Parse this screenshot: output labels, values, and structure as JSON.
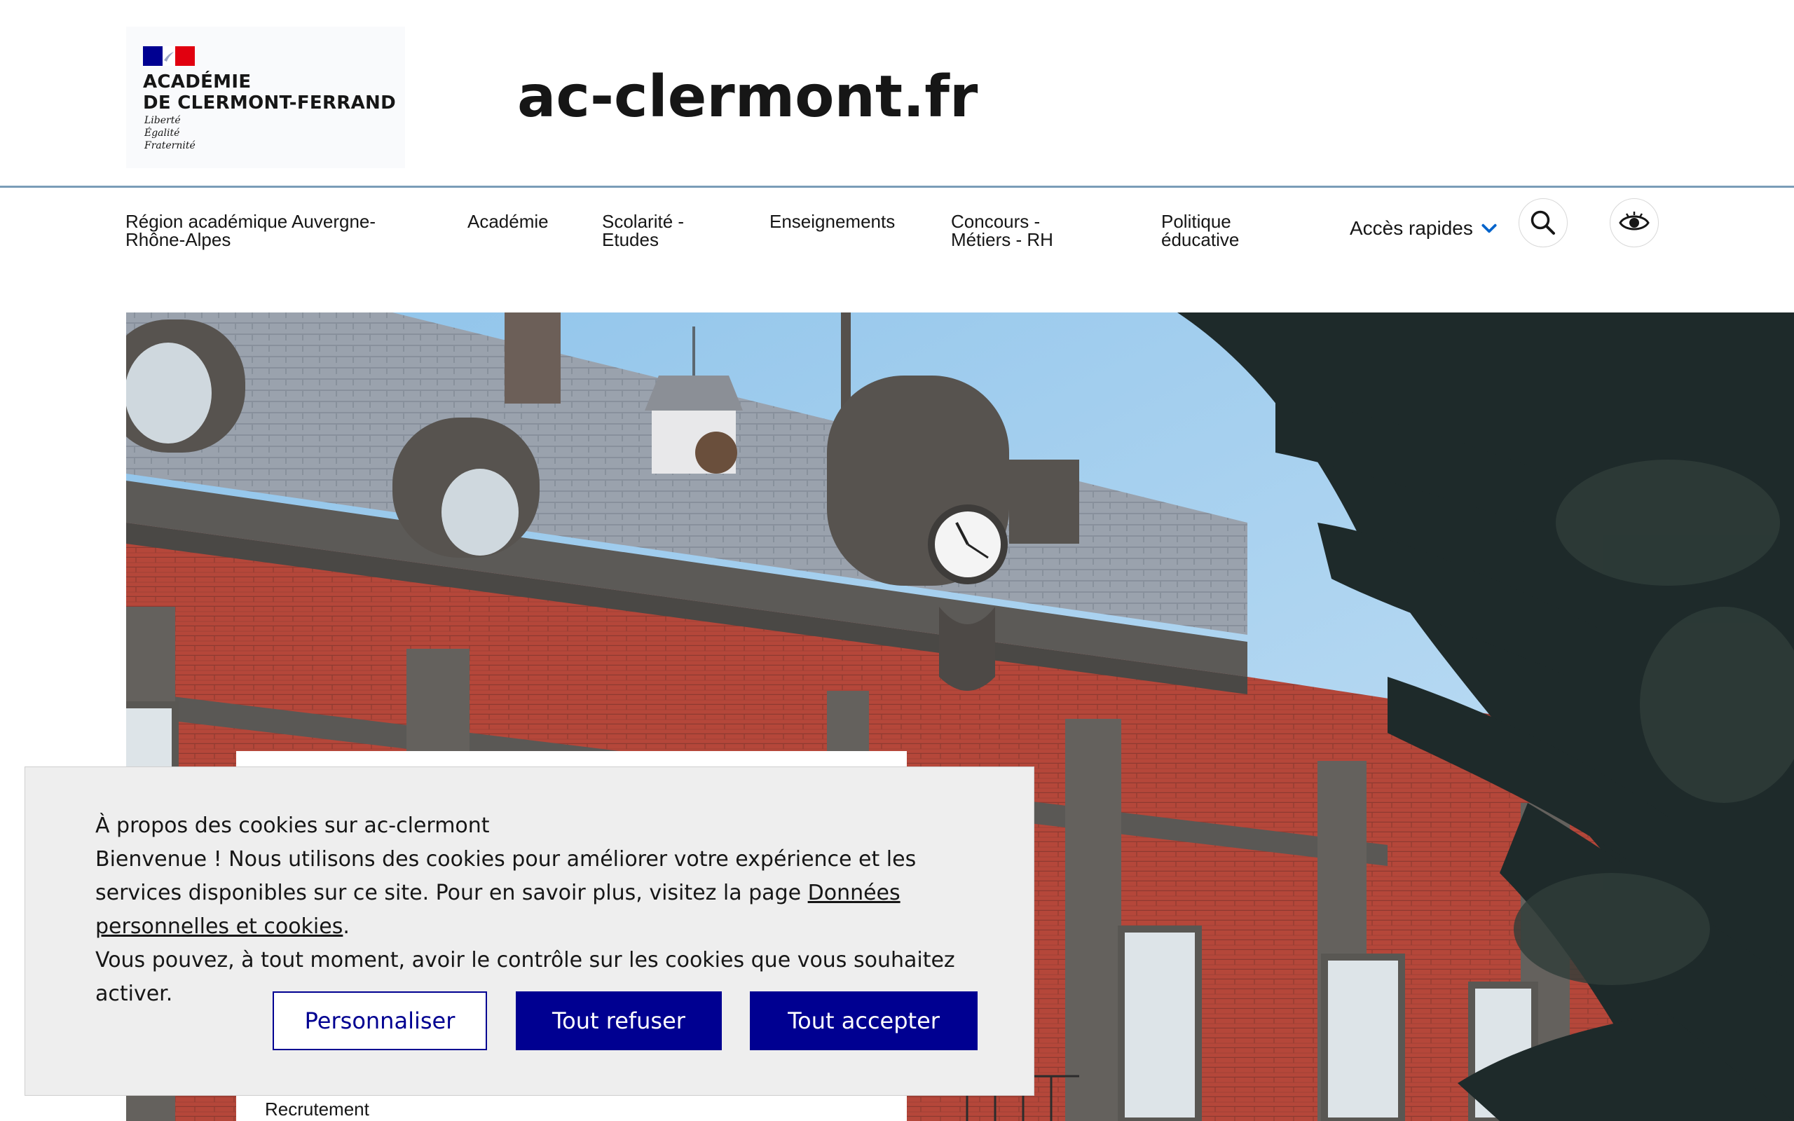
{
  "header": {
    "logo": {
      "name_line1": "ACADÉMIE",
      "name_line2": "DE CLERMONT-FERRAND",
      "motto": [
        "Liberté",
        "Égalité",
        "Fraternité"
      ],
      "flag_colors": [
        "#000091",
        "#ffffff",
        "#e1000f"
      ]
    },
    "site_title": "ac-clermont.fr"
  },
  "nav": {
    "items": [
      {
        "line1": "Région académique Auvergne-",
        "line2": "Rhône-Alpes"
      },
      {
        "line1": "Académie",
        "line2": ""
      },
      {
        "line1": "Scolarité -",
        "line2": "Etudes"
      },
      {
        "line1": "Enseignements",
        "line2": ""
      },
      {
        "line1": "Concours -",
        "line2": "Métiers - RH"
      },
      {
        "line1": "Politique",
        "line2": "éducative"
      }
    ],
    "quick_access": "Accès rapides",
    "quick_access_icon": "chevron-down-icon",
    "search_icon": "search-icon",
    "display_settings_icon": "eye-icon",
    "accent_color": "#0063cb"
  },
  "hero": {
    "image": "Rectorat building facade with clock and cedar tree",
    "caption_link": "Recrutement"
  },
  "cookie_banner": {
    "title": "À propos des cookies sur ac-clermont",
    "body_before_link": "Bienvenue ! Nous utilisons des cookies pour améliorer votre expérience et les services disponibles sur ce site. Pour en savoir plus, visitez la page ",
    "link_text": "Données personnelles et cookies",
    "body_after_link": ".",
    "body_last": "Vous pouvez, à tout moment, avoir le contrôle sur les cookies que vous souhaitez activer.",
    "buttons": {
      "customize": "Personnaliser",
      "refuse": "Tout refuser",
      "accept": "Tout accepter"
    },
    "button_color": "#000091"
  }
}
